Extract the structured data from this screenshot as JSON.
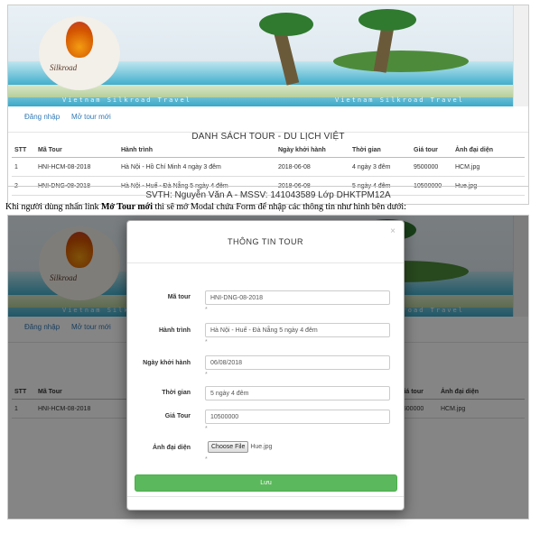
{
  "banner": {
    "logo_text": "Silkroad",
    "tagline_left": "Vietnam Silkroad Travel",
    "tagline_right": "Vietnam Silkroad Travel"
  },
  "nav": {
    "login_label": "Đăng nhập",
    "new_tour_label": "Mở tour mới"
  },
  "list": {
    "title": "DANH SÁCH TOUR - DU LỊCH VIỆT",
    "columns": [
      "STT",
      "Mã Tour",
      "Hành trình",
      "Ngày khởi hành",
      "Thời gian",
      "Giá tour",
      "Ảnh đại diện"
    ],
    "rows": [
      [
        "1",
        "HNI-HCM-08-2018",
        "Hà Nội - Hồ Chí Minh 4 ngày 3 đêm",
        "2018-06-08",
        "4 ngày 3 đêm",
        "9500000",
        "HCM.jpg"
      ],
      [
        "2",
        "HNI-DNG-08-2018",
        "Hà Nội - Huế - Đà Nẵng 5 ngày 4 đêm",
        "2018-06-08",
        "5 ngày 4 đêm",
        "10500000",
        "Hue.jpg"
      ]
    ]
  },
  "footer": {
    "text": "SVTH: Nguyễn Văn A - MSSV: 141043589 Lớp DHKTPM12A"
  },
  "caption": {
    "before": "Khi người dùng nhấn link ",
    "bold": "Mở Tour mới",
    "after": " thì sẽ mở Modal chứa Form để nhập các thông tin như hình bên dưới:"
  },
  "background_table": {
    "columns": [
      "STT",
      "Mã Tour",
      "Giá tour",
      "Ảnh đại diện"
    ],
    "row": [
      "1",
      "HNI-HCM-08-2018",
      "9500000",
      "HCM.jpg"
    ]
  },
  "modal": {
    "title": "THÔNG TIN TOUR",
    "close_glyph": "×",
    "fields": {
      "ma_tour_label": "Mã tour",
      "ma_tour_value": "HNI-DNG-08-2018",
      "hanh_trinh_label": "Hành trình",
      "hanh_trinh_value": "Hà Nội - Huế - Đà Nẵng 5 ngày 4 đêm",
      "ngay_label": "Ngày khởi hành",
      "ngay_value": "06/08/2018",
      "thoi_gian_label": "Thời gian",
      "thoi_gian_value": "5 ngày 4 đêm",
      "gia_label": "Giá Tour",
      "gia_value": "10500000",
      "anh_label": "Ảnh đại diện",
      "choose_file_label": "Choose File",
      "file_name": "Hue.jpg"
    },
    "required_mark": "*",
    "save_label": "Lưu"
  },
  "colors": {
    "link": "#337ab7",
    "save_button": "#5cb85c",
    "overlay": "rgba(0,0,0,0.48)"
  }
}
